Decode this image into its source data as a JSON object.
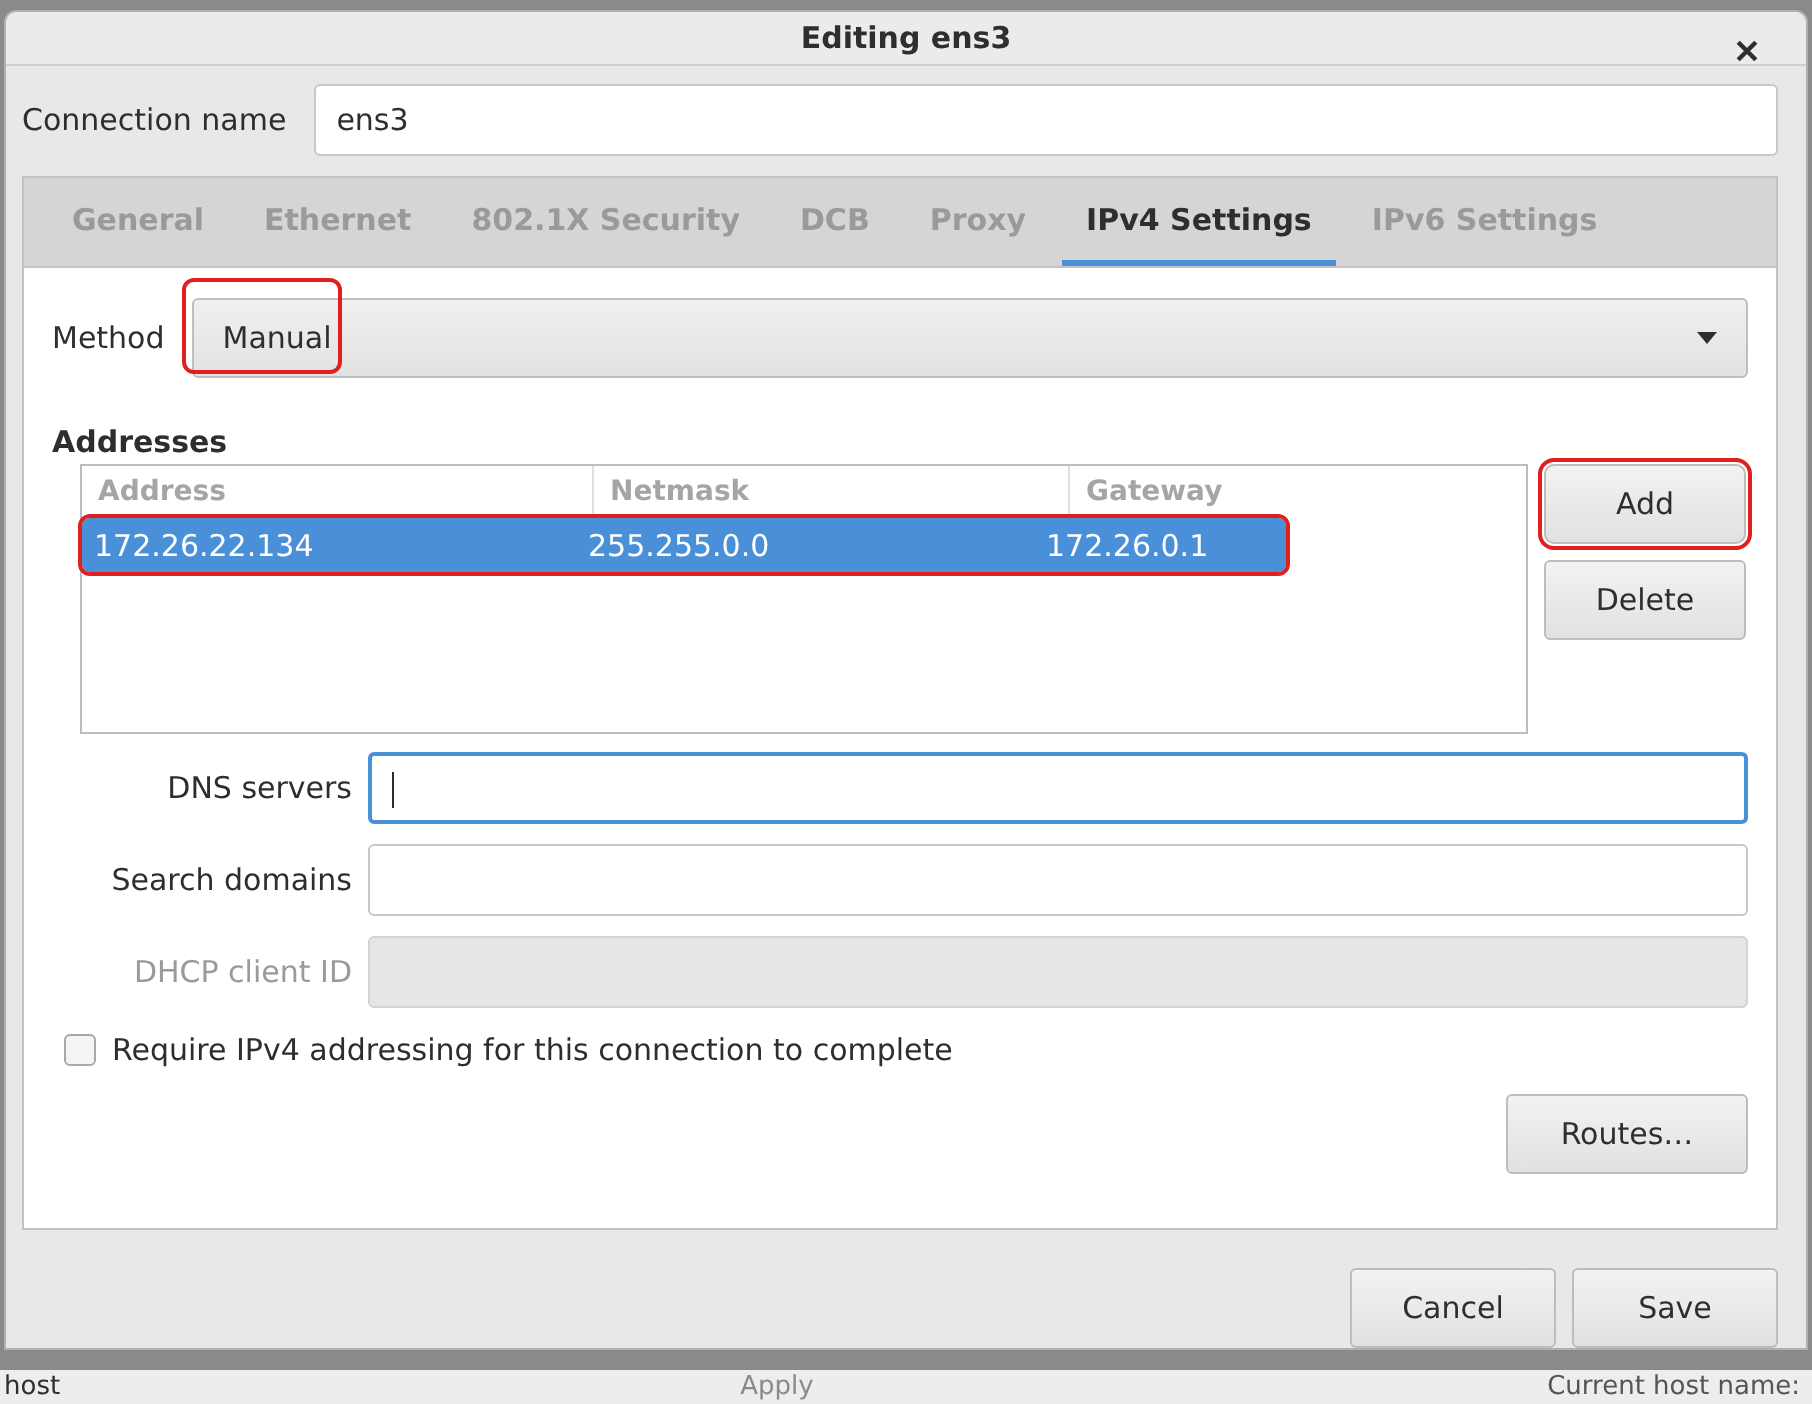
{
  "window": {
    "title": "Editing ens3"
  },
  "connection_name": {
    "label": "Connection name",
    "value": "ens3"
  },
  "tabs": [
    {
      "label": "General",
      "selected": false
    },
    {
      "label": "Ethernet",
      "selected": false
    },
    {
      "label": "802.1X Security",
      "selected": false
    },
    {
      "label": "DCB",
      "selected": false
    },
    {
      "label": "Proxy",
      "selected": false
    },
    {
      "label": "IPv4 Settings",
      "selected": true
    },
    {
      "label": "IPv6 Settings",
      "selected": false
    }
  ],
  "method": {
    "label": "Method",
    "value": "Manual",
    "highlighted": true
  },
  "addresses": {
    "title": "Addresses",
    "columns": [
      "Address",
      "Netmask",
      "Gateway"
    ],
    "rows": [
      {
        "cells": [
          "172.26.22.134",
          "255.255.0.0",
          "172.26.0.1"
        ],
        "selected": true,
        "highlighted": true
      }
    ],
    "buttons": [
      {
        "label": "Add",
        "highlighted": true
      },
      {
        "label": "Delete",
        "highlighted": false
      }
    ]
  },
  "fields": [
    {
      "label": "DNS servers",
      "focused": true,
      "disabled": false
    },
    {
      "label": "Search domains",
      "focused": false,
      "disabled": false
    },
    {
      "label": "DHCP client ID",
      "focused": false,
      "disabled": true
    }
  ],
  "require_checkbox": {
    "label": "Require IPv4 addressing for this connection to complete",
    "checked": false
  },
  "routes_button": "Routes…",
  "footer_buttons": [
    "Cancel",
    "Save"
  ],
  "background": {
    "texts": [
      "host",
      "Apply",
      "Current host name:"
    ]
  }
}
